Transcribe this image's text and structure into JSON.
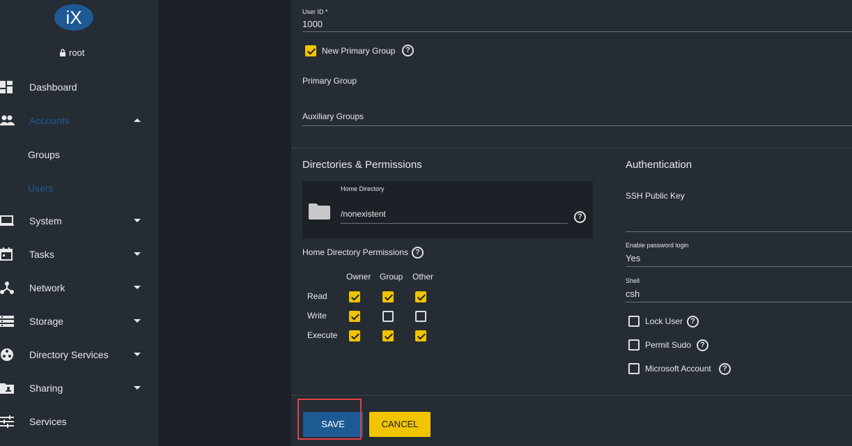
{
  "sidebar": {
    "username": "root",
    "logo_text": "iX",
    "nav": [
      {
        "label": "Dashboard",
        "icon": "dashboard-icon"
      },
      {
        "label": "Accounts",
        "icon": "people-icon"
      },
      {
        "label": "System",
        "icon": "laptop-icon"
      },
      {
        "label": "Tasks",
        "icon": "calendar-icon"
      },
      {
        "label": "Network",
        "icon": "network-icon"
      },
      {
        "label": "Storage",
        "icon": "storage-icon"
      },
      {
        "label": "Directory Services",
        "icon": "directory-icon"
      },
      {
        "label": "Sharing",
        "icon": "folder-share-icon"
      },
      {
        "label": "Services",
        "icon": "tune-icon"
      }
    ],
    "accounts_sub": [
      "Groups",
      "Users"
    ]
  },
  "form": {
    "user_id_label": "User ID *",
    "user_id_value": "1000",
    "new_primary_group_label": "New Primary Group",
    "new_primary_group_checked": true,
    "primary_group_label": "Primary Group",
    "auxiliary_groups_label": "Auxiliary Groups",
    "dirs_title": "Directories & Permissions",
    "home_dir_label": "Home Directory",
    "home_dir_value": "/nonexistent",
    "home_perms_label": "Home Directory Permissions",
    "perm_cols": [
      "Owner",
      "Group",
      "Other"
    ],
    "perm_rows": [
      "Read",
      "Write",
      "Execute"
    ],
    "perm_matrix": [
      [
        true,
        true,
        true
      ],
      [
        true,
        false,
        false
      ],
      [
        true,
        true,
        true
      ]
    ],
    "auth_title": "Authentication",
    "ssh_key_label": "SSH Public Key",
    "password_login_label": "Enable password login",
    "password_login_value": "Yes",
    "shell_label": "Shell",
    "shell_value": "csh",
    "lock_user_label": "Lock User",
    "permit_sudo_label": "Permit Sudo",
    "microsoft_account_label": "Microsoft Account"
  },
  "actions": {
    "save_label": "SAVE",
    "cancel_label": "CANCEL"
  },
  "colors": {
    "accent_blue": "#1d5a94",
    "accent_yellow": "#f0c400",
    "highlight_red": "#e0404a"
  }
}
